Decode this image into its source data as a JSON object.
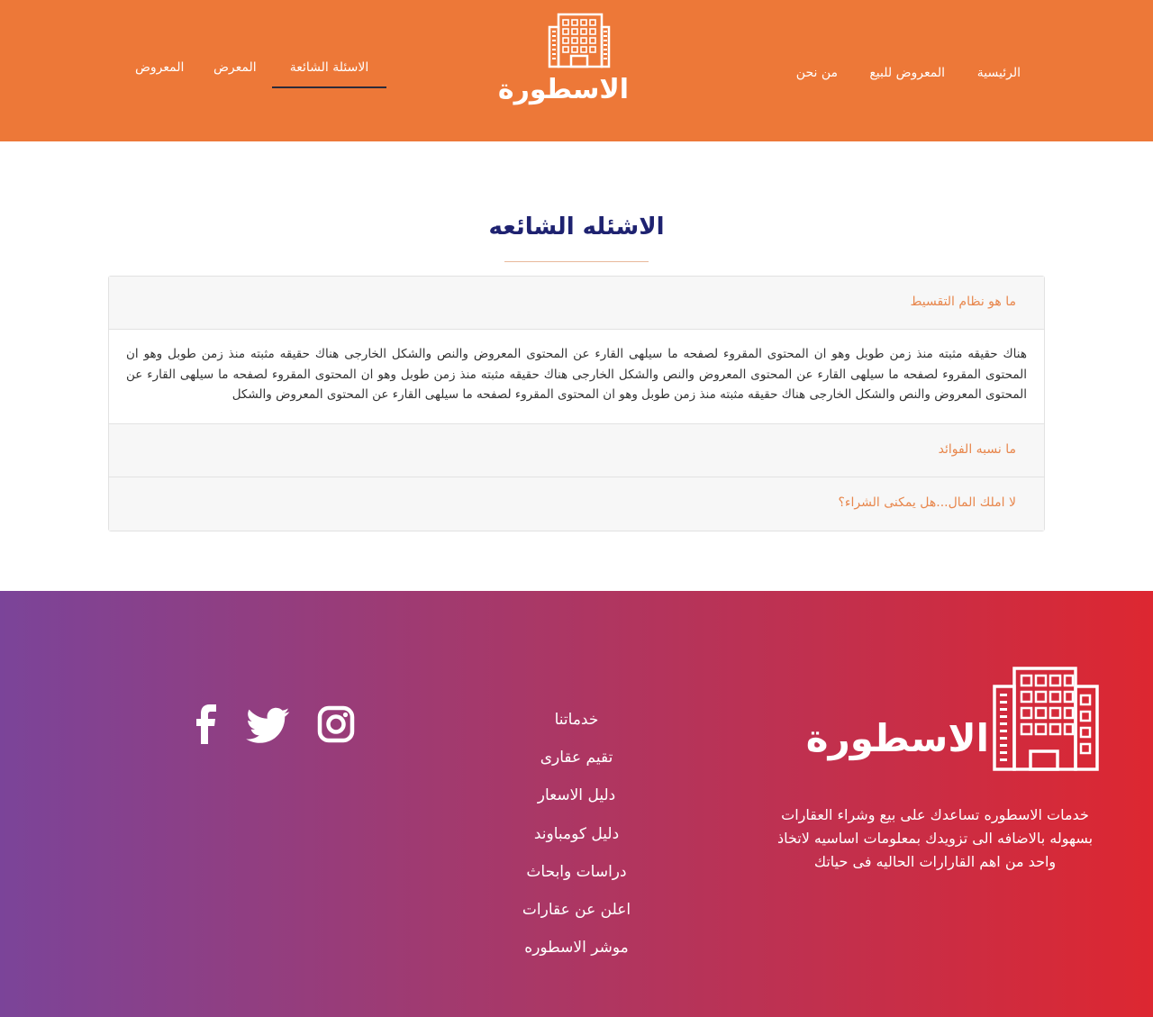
{
  "header": {
    "nav_right": [
      "الرئيسية",
      "المعروض للبيع",
      "من نحن"
    ],
    "nav_left": [
      "الاسئلة الشائعة",
      "المعرض",
      "المعروض"
    ],
    "active_item": "الاسئلة الشائعة",
    "logo_text": "الاسطورة",
    "logo_icon": "building-icon"
  },
  "main": {
    "title": "الاشئله الشائعه",
    "faq": [
      {
        "question": "ما هو نظام التقسيط",
        "answer": "هناك حقيقه مثبته منذ زمن طوبل وهو ان المحتوى المقروء لصفحه ما سيلهى القارء عن المحتوى المعروض والنص والشكل الخارجى هناك حقيقه مثبته منذ زمن طوبل وهو ان المحتوى المقروء لصفحه ما سيلهى القارء عن المحتوى المعروض والنص والشكل الخارجى هناك حقيقه مثبته منذ زمن طوبل وهو ان المحتوى المقروء لصفحه ما سيلهى القارء عن المحتوى المعروض والنص والشكل الخارجى هناك حقيقه مثبته منذ زمن طوبل وهو ان المحتوى المقروء لصفحه ما سيلهى القارء عن المحتوى المعروض والشكل"
      },
      {
        "question": "ما نسبه الفوائد"
      },
      {
        "question": "لا املك المال...هل يمكنى الشراء؟"
      }
    ]
  },
  "footer": {
    "logo_text": "الاسطورة",
    "about": "خدمات الاسطوره تساعدك على بيع وشراء العقارات بسهوله بالاضافه الى تزويدك بمعلومات اساسيه لاتخاذ واحد من اهم القارارات الحاليه فى حياتك",
    "links": [
      "خدماتنا",
      "تقيم عقارى",
      "دليل الاسعار",
      "دليل كومباوند",
      "دراسات وابحاث",
      "اعلن عن عقارات",
      "موشر الاسطوره"
    ],
    "social": [
      "instagram-icon",
      "twitter-icon",
      "facebook-icon"
    ]
  },
  "colors": {
    "header_bg": "#ed7838",
    "title": "#1e2270",
    "faq_question": "#e8874d",
    "footer_gradient_start": "#7b4499",
    "footer_gradient_end": "#dd2731"
  }
}
